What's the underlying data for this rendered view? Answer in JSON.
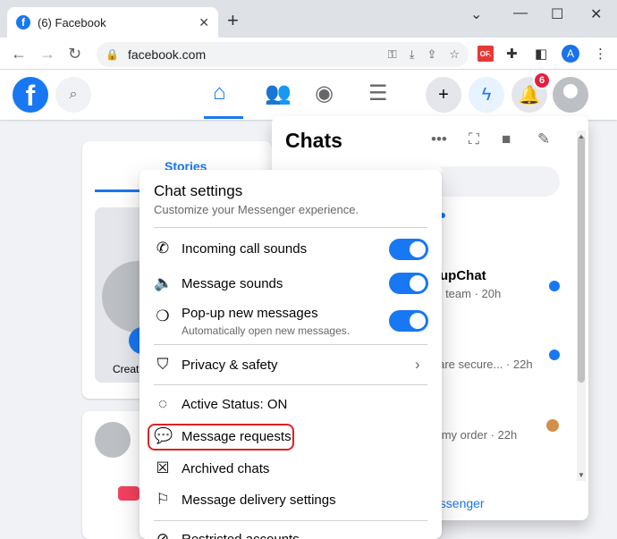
{
  "browser": {
    "tab_title": "(6) Facebook",
    "tab_close": "✕",
    "new_tab": "+",
    "url": "facebook.com",
    "profile_letter": "A",
    "ext_label": "OF."
  },
  "header": {
    "logo": "f",
    "notification_count": "6"
  },
  "feed": {
    "stories_tab": "Stories",
    "create_label": "Creat"
  },
  "chats": {
    "title": "Chats",
    "items": [
      {
        "name": "upChat",
        "snippet": "go team · 20h"
      },
      {
        "snippet": "s are secure... · 22h"
      },
      {
        "snippet": "el my order · 22h"
      }
    ],
    "see_all": "essenger"
  },
  "settings": {
    "title": "Chat settings",
    "subtitle": "Customize your Messenger experience.",
    "rows": [
      {
        "label": "Incoming call sounds",
        "toggle_on": true
      },
      {
        "label": "Message sounds",
        "toggle_on": true
      },
      {
        "label": "Pop-up new messages",
        "sub": "Automatically open new messages.",
        "toggle_on": true
      },
      {
        "label": "Privacy & safety"
      },
      {
        "label": "Active Status: ON"
      },
      {
        "label": "Message requests"
      },
      {
        "label": "Archived chats"
      },
      {
        "label": "Message delivery settings"
      },
      {
        "label": "Restricted accounts"
      }
    ]
  },
  "colors": {
    "brand": "#1877f2",
    "highlight": "#e02020",
    "badge": "#e41e3f"
  }
}
